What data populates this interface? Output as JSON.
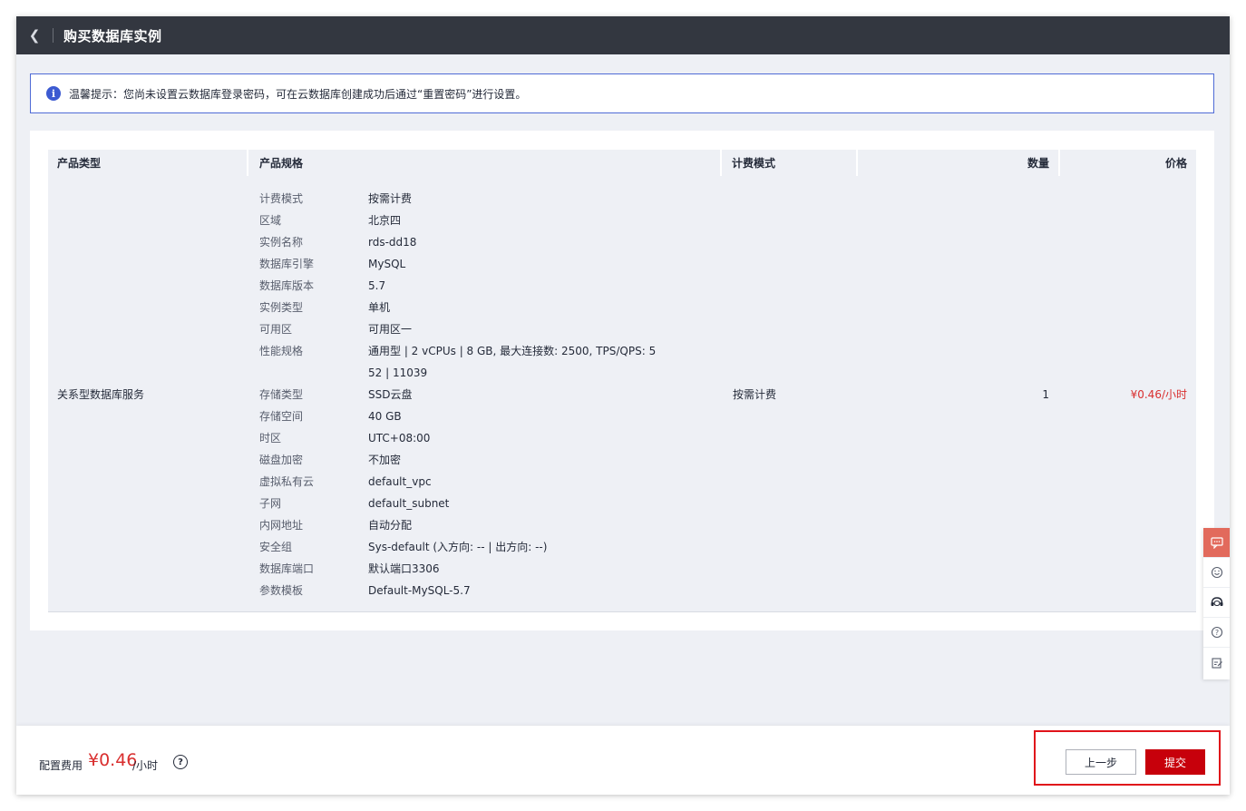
{
  "header": {
    "title": "购买数据库实例",
    "back_icon": "chevron-left-icon"
  },
  "notice": {
    "icon": "info-icon",
    "icon_glyph": "i",
    "text": "温馨提示：您尚未设置云数据库登录密码，可在云数据库创建成功后通过“重置密码”进行设置。"
  },
  "table": {
    "headers": {
      "type": "产品类型",
      "spec": "产品规格",
      "mode": "计费模式",
      "qty": "数量",
      "price": "价格"
    },
    "row": {
      "type": "关系型数据库服务",
      "mode": "按需计费",
      "qty": "1",
      "price": "¥0.46/小时",
      "specs": [
        {
          "key": "计费模式",
          "value": "按需计费"
        },
        {
          "key": "区域",
          "value": "北京四"
        },
        {
          "key": "实例名称",
          "value": "rds-dd18"
        },
        {
          "key": "数据库引擎",
          "value": "MySQL"
        },
        {
          "key": "数据库版本",
          "value": "5.7"
        },
        {
          "key": "实例类型",
          "value": "单机"
        },
        {
          "key": "可用区",
          "value": "可用区一"
        },
        {
          "key": "性能规格",
          "value": "通用型 | 2 vCPUs | 8 GB, 最大连接数: 2500, TPS/QPS: 5"
        },
        {
          "key": "",
          "value": "52 | 11039"
        },
        {
          "key": "存储类型",
          "value": "SSD云盘"
        },
        {
          "key": "存储空间",
          "value": "40 GB"
        },
        {
          "key": "时区",
          "value": "UTC+08:00"
        },
        {
          "key": "磁盘加密",
          "value": "不加密"
        },
        {
          "key": "虚拟私有云",
          "value": "default_vpc"
        },
        {
          "key": "子网",
          "value": "default_subnet"
        },
        {
          "key": "内网地址",
          "value": "自动分配"
        },
        {
          "key": "安全组",
          "value": "Sys-default (入方向: -- | 出方向: --)"
        },
        {
          "key": "数据库端口",
          "value": "默认端口3306"
        },
        {
          "key": "参数模板",
          "value": "Default-MySQL-5.7"
        }
      ]
    }
  },
  "side_tools": [
    "chat-icon",
    "smile-icon",
    "headset-icon",
    "help-circle-icon",
    "edit-note-icon"
  ],
  "footer": {
    "fee_label": "配置费用",
    "fee_amount": "¥0.46",
    "fee_unit": "/小时",
    "help_glyph": "?",
    "prev_label": "上一步",
    "submit_label": "提交"
  },
  "colors": {
    "topbar": "#333740",
    "accent_red": "#c7000b",
    "price_red": "#d92f2f",
    "highlight": "#e0131a",
    "info_blue": "#3c5ad1"
  }
}
